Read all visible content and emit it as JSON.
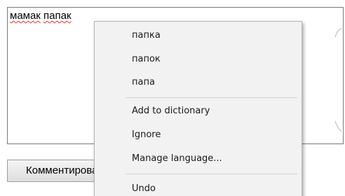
{
  "textarea": {
    "word1": "мамак",
    "word2": "папак"
  },
  "comment_button": {
    "label": "Комментировать"
  },
  "context_menu": {
    "suggestions": [
      "папка",
      "папок",
      "папа"
    ],
    "actions": [
      "Add to dictionary",
      "Ignore",
      "Manage language..."
    ],
    "edit_actions": [
      "Undo"
    ]
  }
}
